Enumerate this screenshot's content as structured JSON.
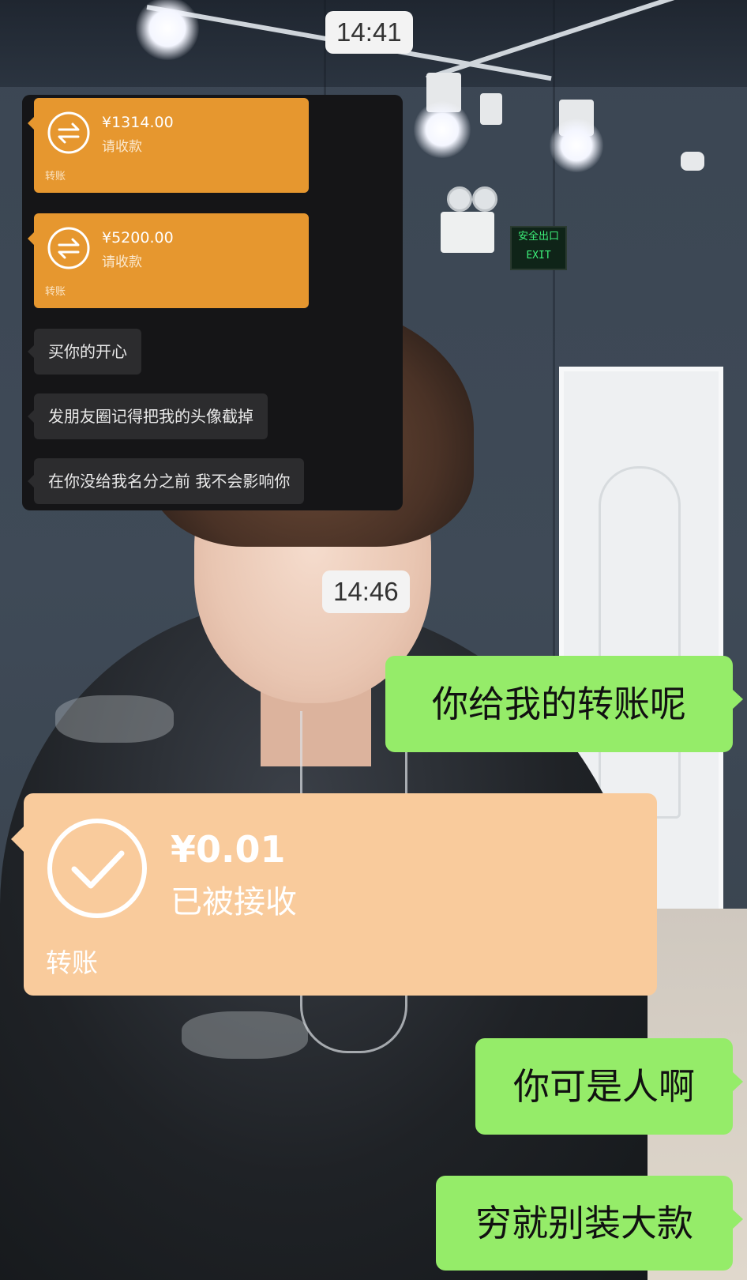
{
  "chat": {
    "time_1": "14:41",
    "time_2": "14:46",
    "embedded_screenshot": {
      "transfer_1": {
        "amount": "¥1314.00",
        "status": "请收款",
        "label": "转账"
      },
      "transfer_2": {
        "amount": "¥5200.00",
        "status": "请收款",
        "label": "转账"
      },
      "messages": [
        "买你的开心",
        "发朋友圈记得把我的头像截掉",
        "在你没给我名分之前 我不会影响你"
      ]
    },
    "outgoing_1": "你给我的转账呢",
    "received_transfer": {
      "amount": "¥0.01",
      "status": "已被接收",
      "label": "转账"
    },
    "outgoing_2": "你可是人啊",
    "outgoing_3": "穷就别装大款"
  },
  "background": {
    "exit_sign_text": "安全出口 EXIT"
  },
  "colors": {
    "outgoing_bubble": "#95ec69",
    "pending_transfer": "#e6972f",
    "received_transfer": "#f9cb9c",
    "dark_card": "#151517"
  },
  "icons": {
    "pending_transfer": "transfer-arrows-icon",
    "received_transfer": "checkmark-circle-icon"
  }
}
